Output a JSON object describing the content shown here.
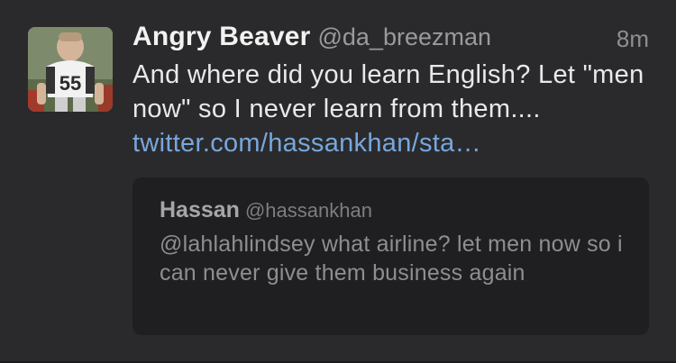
{
  "tweet": {
    "display_name": "Angry Beaver",
    "handle": "@da_breezman",
    "timestamp": "8m",
    "text": "And where did you learn English? Let \"men now\" so I never learn from them.... ",
    "link": "twitter.com/hassankhan/sta…"
  },
  "quote": {
    "display_name": "Hassan",
    "handle": "@hassankhan",
    "text": "@lahlahlindsey what airline? let men now so i can never give them business again"
  },
  "colors": {
    "background": "#2a2a2c",
    "link": "#78a7dc",
    "quote_card": "#1f1f21"
  },
  "avatar": {
    "jersey_number": "55"
  }
}
